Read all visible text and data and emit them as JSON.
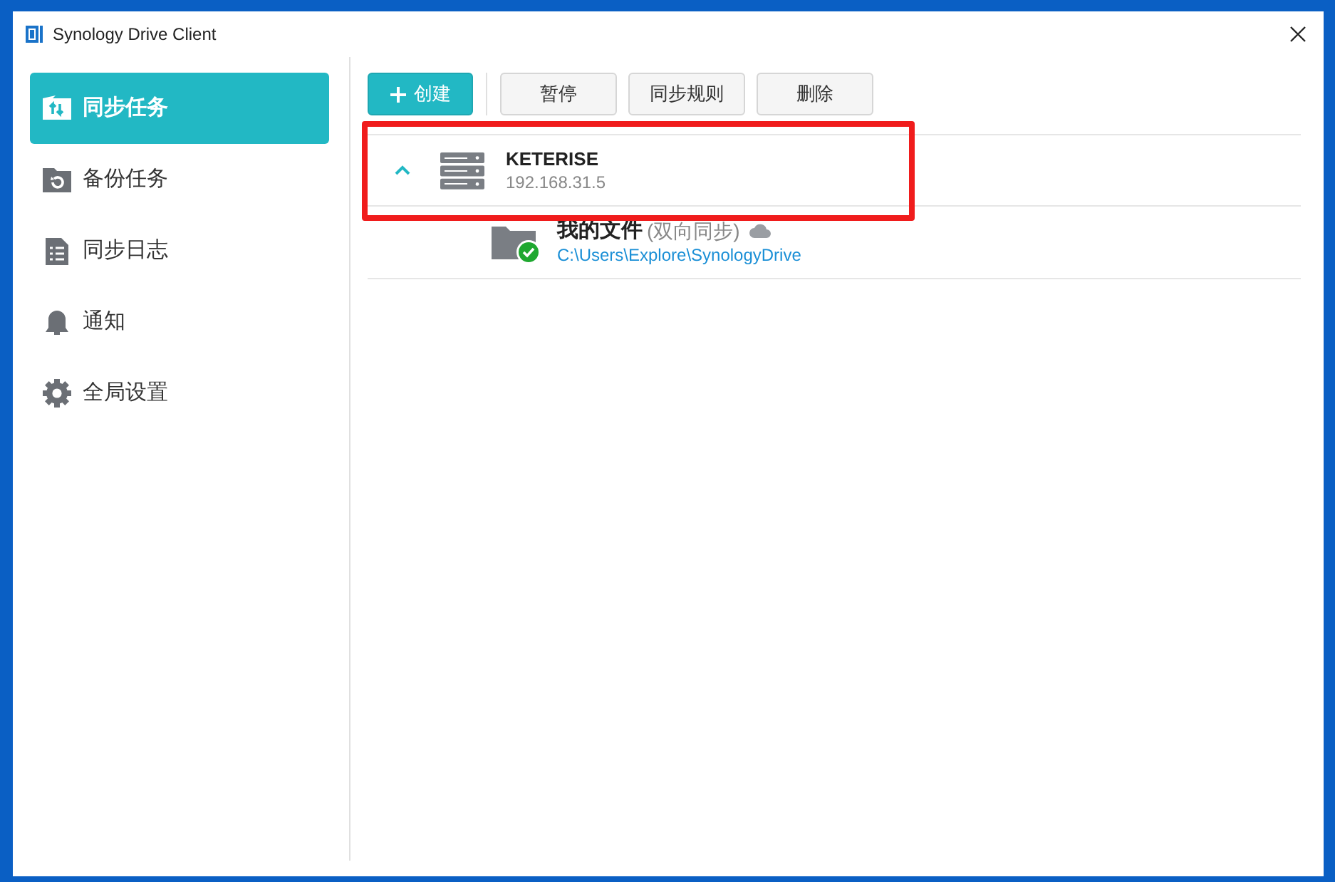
{
  "window": {
    "title": "Synology Drive Client"
  },
  "sidebar": {
    "items": [
      {
        "label": "同步任务",
        "kind": "sync",
        "selected": true
      },
      {
        "label": "备份任务",
        "kind": "backup",
        "selected": false
      },
      {
        "label": "同步日志",
        "kind": "log",
        "selected": false
      },
      {
        "label": "通知",
        "kind": "notice",
        "selected": false
      },
      {
        "label": "全局设置",
        "kind": "settings",
        "selected": false
      }
    ]
  },
  "toolbar": {
    "buttons": [
      {
        "label": "创建",
        "kind": "primary"
      },
      {
        "label": "暂停",
        "kind": "default"
      },
      {
        "label": "同步规则",
        "kind": "default"
      },
      {
        "label": "删除",
        "kind": "default"
      }
    ]
  },
  "servers": [
    {
      "name": "KETERISE",
      "address": "192.168.31.5",
      "expanded": true,
      "highlighted": true,
      "children": [
        {
          "name": "我的文件",
          "mode": "(双向同步)",
          "path": "C:\\Users\\Explore\\SynologyDrive"
        }
      ]
    }
  ]
}
